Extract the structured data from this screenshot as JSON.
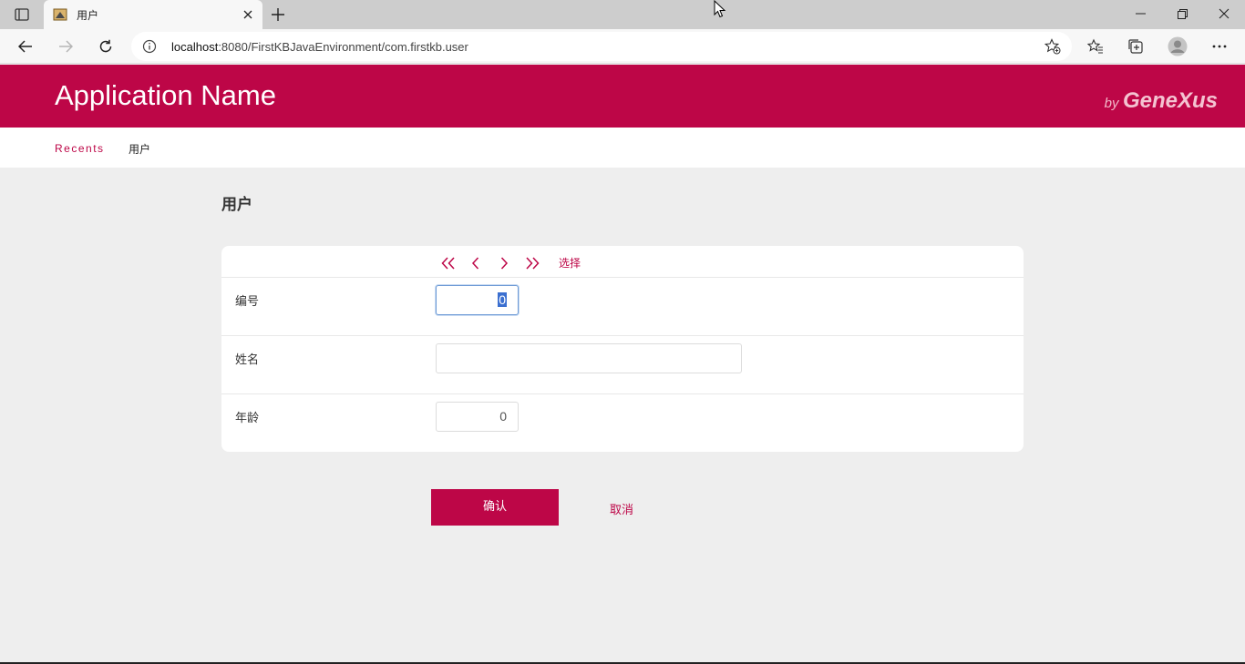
{
  "browser": {
    "tab_title": "用户",
    "url_host": "localhost",
    "url_rest": ":8080/FirstKBJavaEnvironment/com.firstkb.user"
  },
  "app": {
    "name": "Application Name",
    "brand_by": "by",
    "brand_name": "GeneXus",
    "accent_color": "#bd0647"
  },
  "breadcrumb": {
    "recents": "Recents",
    "current": "用户"
  },
  "page": {
    "title": "用户"
  },
  "toolbar": {
    "first_icon": "double-chevron-left-icon",
    "prev_icon": "chevron-left-icon",
    "next_icon": "chevron-right-icon",
    "last_icon": "double-chevron-right-icon",
    "select_label": "选择"
  },
  "form": {
    "id_label": "编号",
    "id_value": "0",
    "name_label": "姓名",
    "name_value": "",
    "age_label": "年龄",
    "age_value": "0"
  },
  "actions": {
    "confirm_label": "确认",
    "cancel_label": "取消"
  }
}
